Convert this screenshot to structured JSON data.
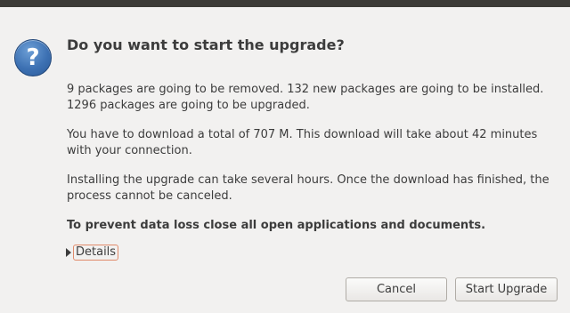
{
  "icon": "question-icon",
  "icon_glyph": "?",
  "dialog": {
    "title": "Do you want to start the upgrade?",
    "paragraphs": [
      "9 packages are going to be removed. 132 new packages are going to be installed. 1296 packages are going to be upgraded.",
      "You have to download a total of 707 M. This download will take about 42 minutes with your connection.",
      "Installing the upgrade can take several hours. Once the download has finished, the process cannot be canceled.",
      "To prevent data loss close all open applications and documents."
    ],
    "details_label": "Details"
  },
  "buttons": {
    "cancel": "Cancel",
    "start": "Start Upgrade"
  },
  "colors": {
    "background": "#f2f1f0",
    "icon_blue": "#3d71b3",
    "focus_outline": "#e08a6a"
  }
}
